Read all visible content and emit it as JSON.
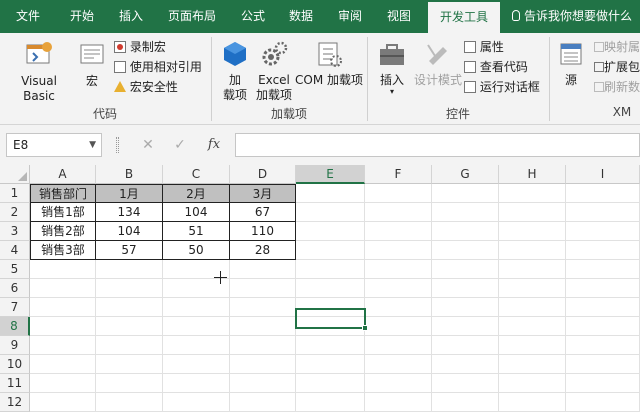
{
  "tabs": [
    "文件",
    "开始",
    "插入",
    "页面布局",
    "公式",
    "数据",
    "审阅",
    "视图",
    "开发工具"
  ],
  "tell_me": "告诉我你想要做什么",
  "ribbon": {
    "code": {
      "label": "代码",
      "visual_basic": "Visual Basic",
      "macros": "宏",
      "record_macro": "录制宏",
      "relative_ref": "使用相对引用",
      "macro_security": "宏安全性"
    },
    "addins": {
      "label": "加载项",
      "addins_line1": "加",
      "addins_line2": "载项",
      "excel_line1": "Excel",
      "excel_line2": "加载项",
      "com": "COM 加载项"
    },
    "controls": {
      "label": "控件",
      "insert": "插入",
      "design_mode": "设计模式",
      "properties": "属性",
      "view_code": "查看代码",
      "run_dialog": "运行对话框"
    },
    "xml": {
      "label": "XM",
      "source": "源",
      "map_props": "映射属",
      "expansion": "扩展包",
      "refresh": "刷新数"
    }
  },
  "formula_bar": {
    "name_box": "E8",
    "fx": "fx",
    "value": ""
  },
  "columns": [
    "A",
    "B",
    "C",
    "D",
    "E",
    "F",
    "G",
    "H",
    "I"
  ],
  "rows": [
    "1",
    "2",
    "3",
    "4",
    "5",
    "6",
    "7",
    "8",
    "9",
    "10",
    "11",
    "12"
  ],
  "selected_cell": "E8",
  "table": {
    "header": [
      "销售部门",
      "1月",
      "2月",
      "3月"
    ],
    "rows": [
      [
        "销售1部",
        "134",
        "104",
        "67"
      ],
      [
        "销售2部",
        "104",
        "51",
        "110"
      ],
      [
        "销售3部",
        "57",
        "50",
        "28"
      ]
    ]
  },
  "colors": {
    "accent": "#217346",
    "header_fill": "#c0c0c0",
    "ribbon_bg": "#f3f3f3"
  }
}
